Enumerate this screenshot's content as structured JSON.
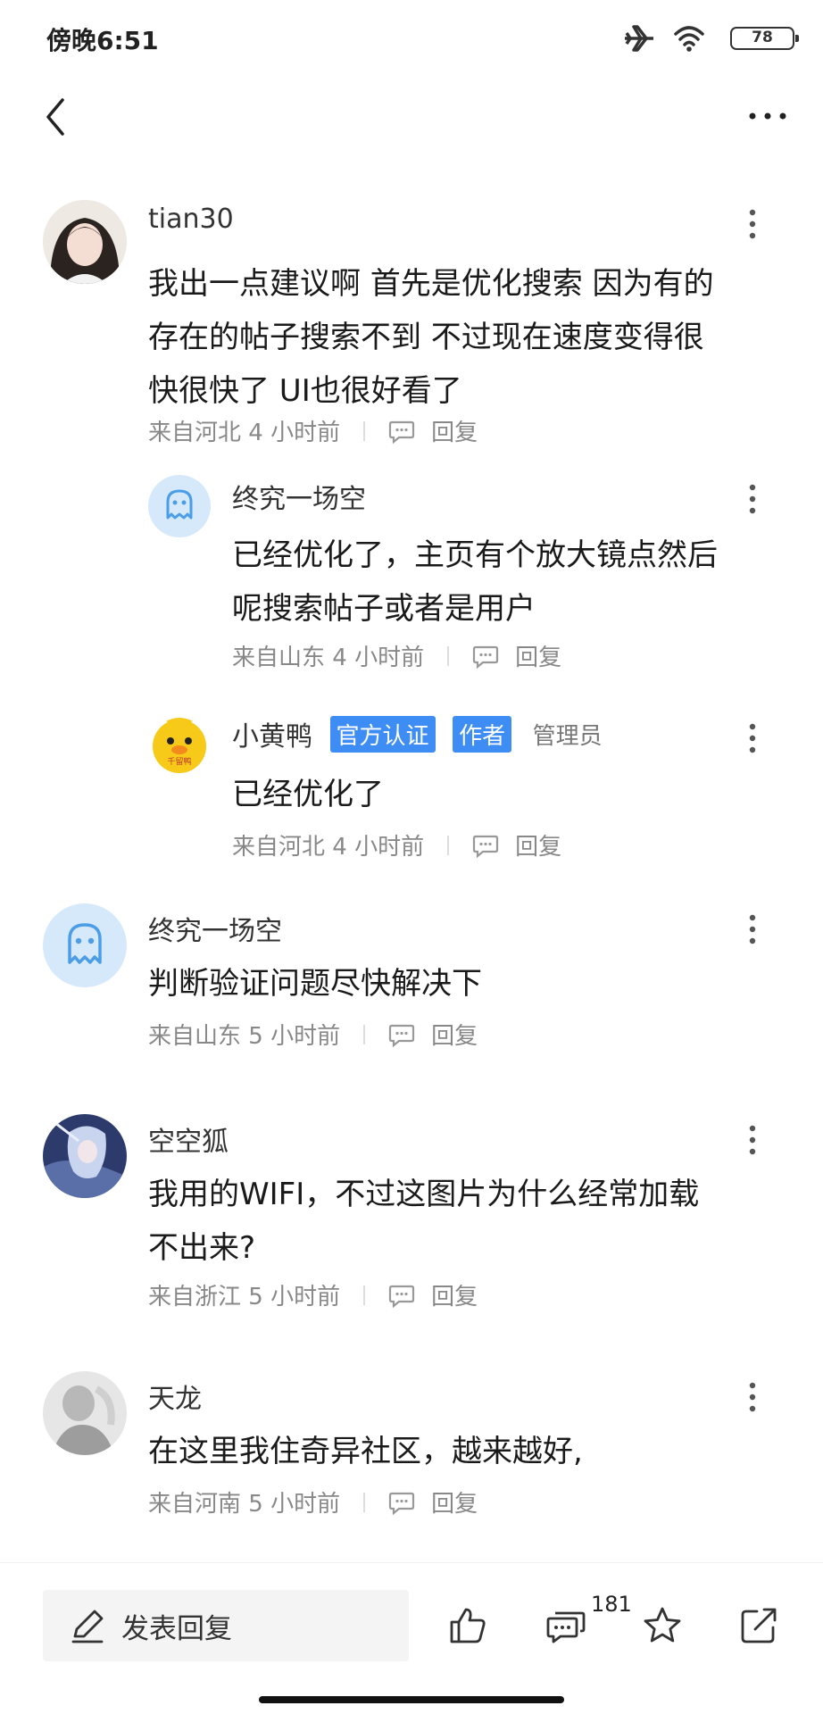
{
  "status": {
    "time": "傍晚6:51",
    "battery": "78"
  },
  "comments": [
    {
      "user": "tian30",
      "text": "我出一点建议啊 首先是优化搜索 因为有的存在的帖子搜索不到 不过现在速度变得很快很快了 UI也很好看了",
      "meta": "来自河北 4 小时前",
      "reply": "回复",
      "replies": [
        {
          "user": "终究一场空",
          "text": "已经优化了，主页有个放大镜点然后呢搜索帖子或者是用户",
          "meta": "来自山东 4 小时前",
          "reply": "回复"
        },
        {
          "user": "小黄鸭",
          "badge1": "官方认证",
          "badge2": "作者",
          "role": "管理员",
          "text": "已经优化了",
          "meta": "来自河北 4 小时前",
          "reply": "回复",
          "avatar_text": "千留鸭"
        }
      ]
    },
    {
      "user": "终究一场空",
      "text": "判断验证问题尽快解决下",
      "meta": "来自山东 5 小时前",
      "reply": "回复"
    },
    {
      "user": "空空狐",
      "text": "我用的WIFI，不过这图片为什么经常加载不出来?",
      "meta": "来自浙江 5 小时前",
      "reply": "回复"
    },
    {
      "user": "天龙",
      "text": "在这里我住奇异社区，越来越好,",
      "meta": "来自河南 5 小时前",
      "reply": "回复"
    }
  ],
  "bottom": {
    "reply_label": "发表回复",
    "comment_count": "181"
  },
  "colors": {
    "badge": "#3d8df5",
    "ghost_avatar_bg": "#d6e9fb",
    "ghost_avatar_fg": "#4a9de6",
    "duck": "#f7c919"
  },
  "icons": [
    "back-icon",
    "more-icon",
    "reply-icon",
    "pen-icon",
    "thumbs-up-icon",
    "comments-icon",
    "star-icon",
    "share-icon"
  ]
}
